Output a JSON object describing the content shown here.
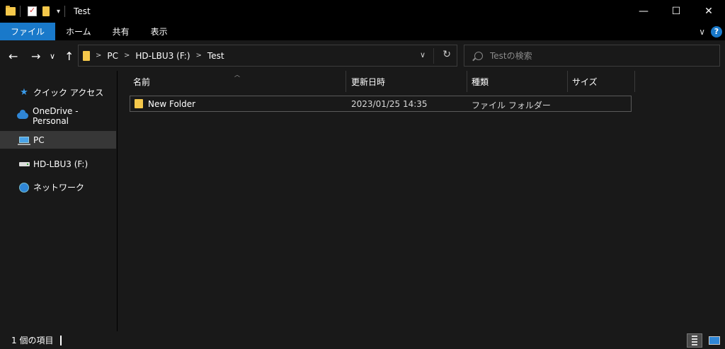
{
  "window": {
    "title": "Test",
    "controls": {
      "minimize": "—",
      "maximize": "☐",
      "close": "✕"
    }
  },
  "ribbon": {
    "tabs": [
      "ファイル",
      "ホーム",
      "共有",
      "表示"
    ],
    "expand_icon": "chevron-down-icon",
    "help_label": "?"
  },
  "nav": {
    "back": "←",
    "forward": "→",
    "recent": "∨",
    "up": "↑"
  },
  "address": {
    "crumbs": [
      "PC",
      "HD-LBU3 (F:)",
      "Test"
    ],
    "refresh": "↻",
    "dropdown": "∨"
  },
  "search": {
    "placeholder": "Testの検索"
  },
  "sidebar": {
    "items": [
      {
        "label": "クイック アクセス",
        "icon": "star-icon"
      },
      {
        "label": "OneDrive - Personal",
        "icon": "cloud-icon"
      },
      {
        "label": "PC",
        "icon": "pc-icon",
        "selected": true
      },
      {
        "label": "HD-LBU3 (F:)",
        "icon": "drive-icon"
      },
      {
        "label": "ネットワーク",
        "icon": "network-icon"
      }
    ]
  },
  "columns": [
    "名前",
    "更新日時",
    "種類",
    "サイズ"
  ],
  "files": [
    {
      "name": "New Folder",
      "modified": "2023/01/25 14:35",
      "type": "ファイル フォルダー",
      "size": ""
    }
  ],
  "status": {
    "count": "1 個の項目"
  },
  "colors": {
    "accent": "#1979ca",
    "folder": "#f5c84b",
    "panel": "#191919"
  }
}
